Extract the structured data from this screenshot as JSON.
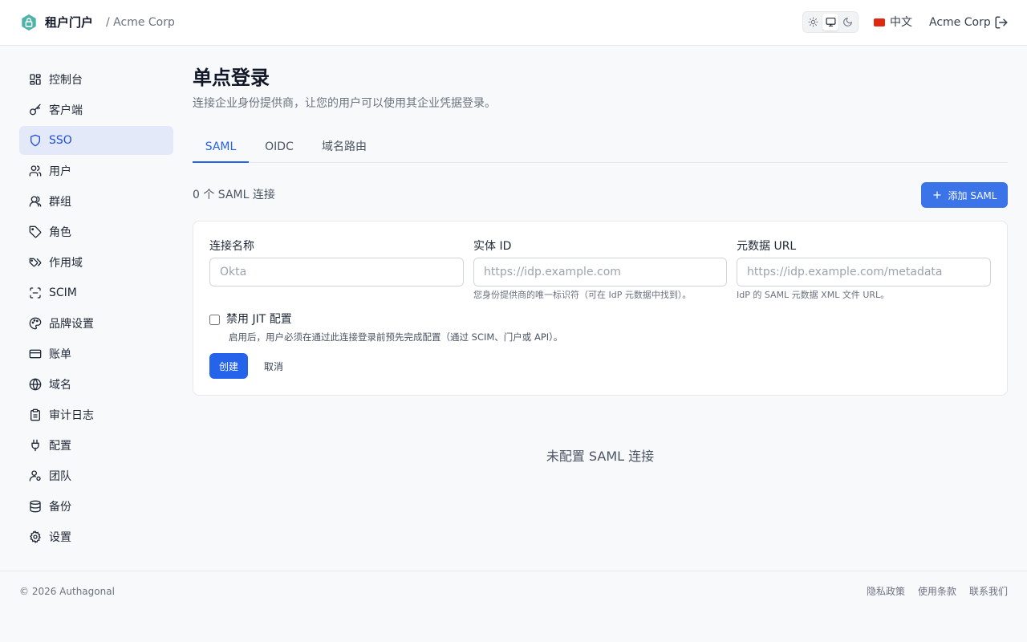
{
  "header": {
    "app_name": "租户门户",
    "org_crumb": "/ Acme Corp",
    "language": "中文",
    "tenant": "Acme Corp",
    "theme_options": [
      "sun-icon",
      "monitor-icon",
      "moon-icon"
    ],
    "theme_selected": "monitor-icon"
  },
  "sidebar": {
    "items": [
      {
        "label": "控制台",
        "icon": "dashboard-icon"
      },
      {
        "label": "客户端",
        "icon": "key-icon"
      },
      {
        "label": "SSO",
        "icon": "shield-icon",
        "active": true
      },
      {
        "label": "用户",
        "icon": "users-icon"
      },
      {
        "label": "群组",
        "icon": "group-icon"
      },
      {
        "label": "角色",
        "icon": "tag-icon"
      },
      {
        "label": "作用域",
        "icon": "tags-icon"
      },
      {
        "label": "SCIM",
        "icon": "scan-icon"
      },
      {
        "label": "品牌设置",
        "icon": "palette-icon"
      },
      {
        "label": "账单",
        "icon": "credit-card-icon"
      },
      {
        "label": "域名",
        "icon": "globe-icon"
      },
      {
        "label": "审计日志",
        "icon": "clipboard-icon"
      },
      {
        "label": "配置",
        "icon": "plug-icon"
      },
      {
        "label": "团队",
        "icon": "user-cog-icon"
      },
      {
        "label": "备份",
        "icon": "database-icon"
      },
      {
        "label": "设置",
        "icon": "gear-icon"
      }
    ]
  },
  "main": {
    "title": "单点登录",
    "description": "连接企业身份提供商，让您的用户可以使用其企业凭据登录。",
    "tabs": [
      {
        "label": "SAML",
        "active": true
      },
      {
        "label": "OIDC"
      },
      {
        "label": "域名路由"
      }
    ],
    "connection_count": "0 个 SAML 连接",
    "add_button": "添加 SAML",
    "form": {
      "name_label": "连接名称",
      "name_placeholder": "Okta",
      "name_value": "",
      "entity_label": "实体 ID",
      "entity_placeholder": "https://idp.example.com",
      "entity_value": "",
      "entity_help": "您身份提供商的唯一标识符（可在 IdP 元数据中找到）。",
      "metadata_label": "元数据 URL",
      "metadata_placeholder": "https://idp.example.com/metadata",
      "metadata_value": "",
      "metadata_help": "IdP 的 SAML 元数据 XML 文件 URL。",
      "jit_label": "禁用 JIT 配置",
      "jit_checked": false,
      "jit_help": "启用后，用户必须在通过此连接登录前预先完成配置（通过 SCIM、门户或 API）。",
      "create_button": "创建",
      "cancel_button": "取消"
    },
    "empty_state": "未配置 SAML 连接"
  },
  "footer": {
    "copyright": "© 2026 Authagonal",
    "links": [
      "隐私政策",
      "使用条款",
      "联系我们"
    ]
  },
  "colors": {
    "accent": "#2563eb",
    "active_nav_bg": "#e3e9f8",
    "logo": "#4fb3a9"
  }
}
